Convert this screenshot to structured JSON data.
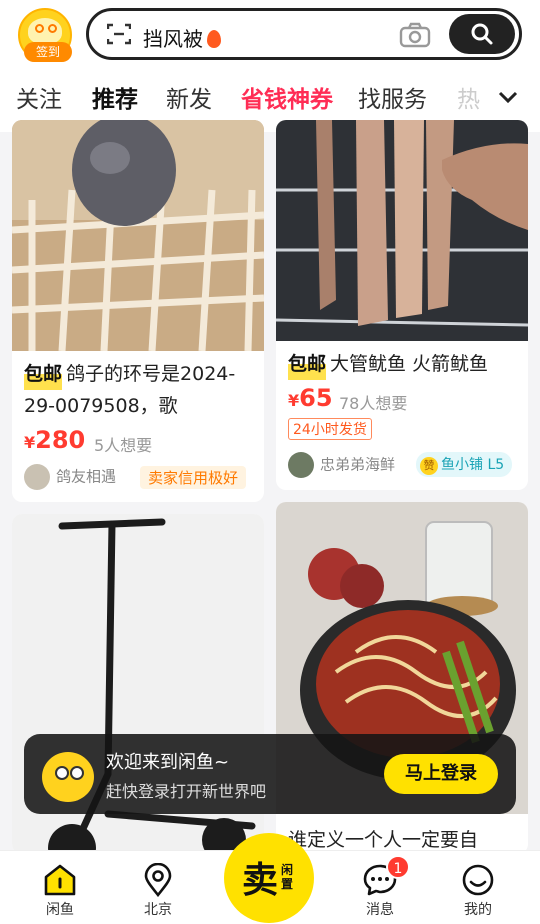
{
  "header": {
    "checkin_label": "签到",
    "search_text": "挡风被",
    "search_icon": "search-icon",
    "camera_icon": "camera-icon",
    "scan_icon": "scan-icon"
  },
  "tabs": [
    {
      "label": "关注"
    },
    {
      "label": "推荐"
    },
    {
      "label": "新发"
    },
    {
      "label": "省钱神券"
    },
    {
      "label": "找服务"
    },
    {
      "label": "热"
    }
  ],
  "feed": {
    "card1": {
      "tag": "包邮",
      "title": "鸽子的环号是2024-29-0079508，歌",
      "yen": "¥",
      "price": "280",
      "wants": "5人想要",
      "seller": "鸽友相遇",
      "badge": "卖家信用极好"
    },
    "card2": {
      "tag": "包邮",
      "title": "大管鱿鱼 火箭鱿鱼",
      "yen": "¥",
      "price": "65",
      "wants": "78人想要",
      "badge": "24小时发货",
      "seller": "忠弟弟海鲜",
      "shop_badge_icon": "赞",
      "shop_badge": "鱼小铺 L5"
    },
    "card4": {
      "title": "谁定义一个人一定要自"
    }
  },
  "toast": {
    "title": "欢迎来到闲鱼~",
    "subtitle": "赶快登录打开新世界吧",
    "button": "马上登录"
  },
  "nav": {
    "home": "闲鱼",
    "city": "北京",
    "sell_big": "卖",
    "sell_small": "闲置",
    "messages": "消息",
    "messages_count": "1",
    "me": "我的"
  },
  "colors": {
    "brand_yellow": "#ffe100",
    "price_red": "#ff3b30",
    "tab_red": "#ff2d55"
  }
}
